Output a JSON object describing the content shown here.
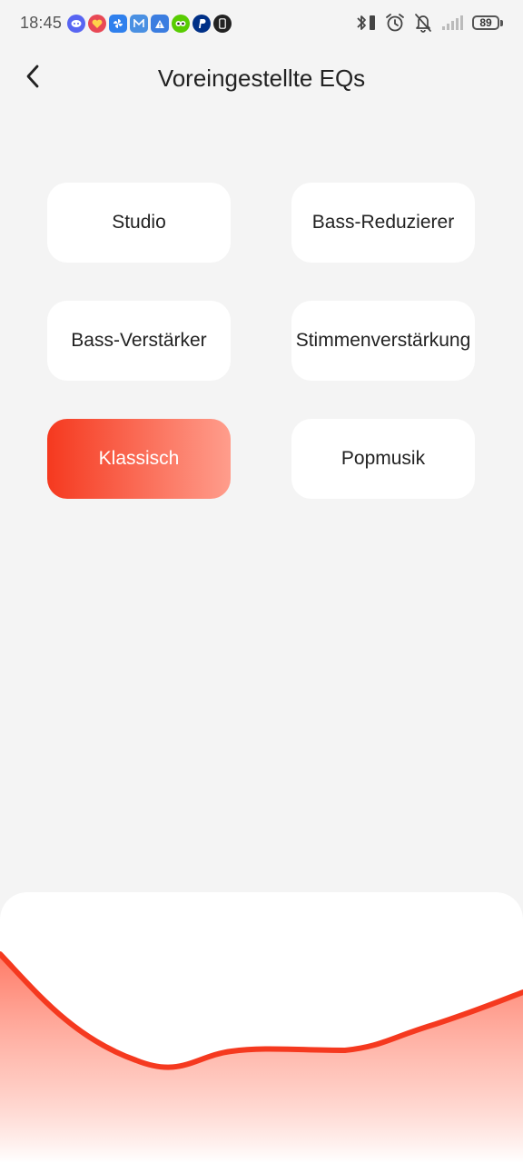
{
  "status_bar": {
    "time": "18:45",
    "battery": "89",
    "notification_icons": [
      {
        "name": "discord-icon",
        "color": "#5865f2"
      },
      {
        "name": "heart-app-icon",
        "color": "#e84855"
      },
      {
        "name": "pinwheel-app-icon",
        "color": "#2f80ed"
      },
      {
        "name": "mail-app-icon",
        "color": "#4a90e2"
      },
      {
        "name": "warning-app-icon",
        "color": "#3b7de0"
      },
      {
        "name": "duolingo-icon",
        "color": "#58cc02"
      },
      {
        "name": "paypal-icon",
        "color": "#003087"
      },
      {
        "name": "phone-app-icon",
        "color": "#222222"
      }
    ],
    "system_icons": [
      "bluetooth-icon",
      "vibrate-icon",
      "alarm-icon",
      "bell-off-icon",
      "signal-icon",
      "battery-icon"
    ]
  },
  "header": {
    "title": "Voreingestellte EQs",
    "back_icon": "chevron-left-icon"
  },
  "presets": [
    {
      "label": "Studio",
      "active": false
    },
    {
      "label": "Bass-Reduzierer",
      "active": false
    },
    {
      "label": "Bass-Verstärker",
      "active": false
    },
    {
      "label": "Stimmenverstärkung",
      "active": false
    },
    {
      "label": "Klassisch",
      "active": true
    },
    {
      "label": "Popmusik",
      "active": false
    }
  ],
  "eq_curve": {
    "color": "#f5391f",
    "fill_top": "#ff7a66",
    "fill_bottom": "#ffffff"
  },
  "colors": {
    "accent": "#f5391f",
    "accent_light": "#ff9d8c",
    "background": "#f4f4f4"
  }
}
